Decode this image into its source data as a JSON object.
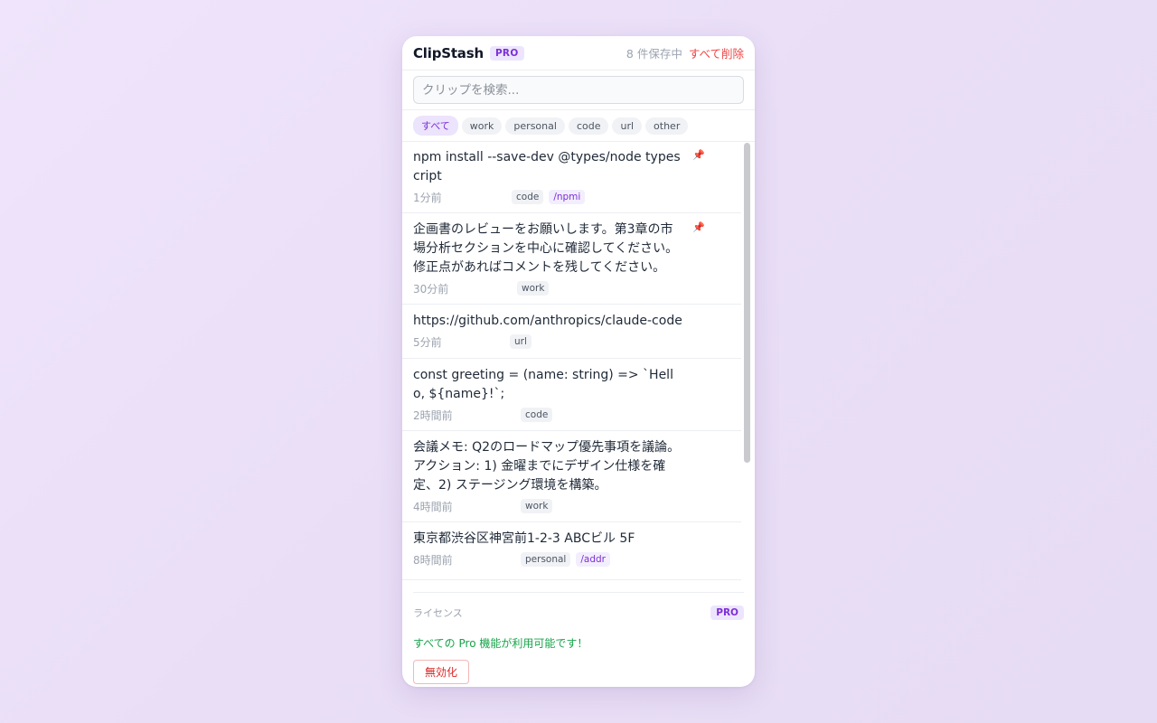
{
  "header": {
    "title": "ClipStash",
    "badge": "PRO",
    "count_text": "8 件保存中",
    "clear_all": "すべて削除"
  },
  "search": {
    "placeholder": "クリップを検索..."
  },
  "filters": [
    {
      "label": "すべて",
      "active": true
    },
    {
      "label": "work",
      "active": false
    },
    {
      "label": "personal",
      "active": false
    },
    {
      "label": "code",
      "active": false
    },
    {
      "label": "url",
      "active": false
    },
    {
      "label": "other",
      "active": false
    }
  ],
  "clips": [
    {
      "text": "npm install --save-dev @types/node typescript",
      "time": "1分前",
      "tag": "code",
      "shortcut": "/npmi",
      "pinned": true
    },
    {
      "text": "企画書のレビューをお願いします。第3章の市場分析セクションを中心に確認してください。修正点があればコメントを残してください。",
      "time": "30分前",
      "tag": "work",
      "shortcut": null,
      "pinned": true
    },
    {
      "text": "https://github.com/anthropics/claude-code",
      "time": "5分前",
      "tag": "url",
      "shortcut": null,
      "pinned": false
    },
    {
      "text": "const greeting = (name: string) => `Hello, ${name}!`;",
      "time": "2時間前",
      "tag": "code",
      "shortcut": null,
      "pinned": false
    },
    {
      "text": "会議メモ: Q2のロードマップ優先事項を議論。アクション: 1) 金曜までにデザイン仕様を確定、2) ステージング環境を構築。",
      "time": "4時間前",
      "tag": "work",
      "shortcut": null,
      "pinned": false
    },
    {
      "text": "東京都渋谷区神宮前1-2-3 ABCビル 5F",
      "time": "8時間前",
      "tag": "personal",
      "shortcut": "/addr",
      "pinned": false
    }
  ],
  "license": {
    "label": "ライセンス",
    "badge": "PRO",
    "message": "すべての Pro 機能が利用可能です！",
    "deactivate": "無効化"
  },
  "icons": {
    "pin": "pushpin-icon"
  },
  "colors": {
    "accent": "#7c2fd6",
    "danger": "#ef4444",
    "success": "#16a34a"
  }
}
